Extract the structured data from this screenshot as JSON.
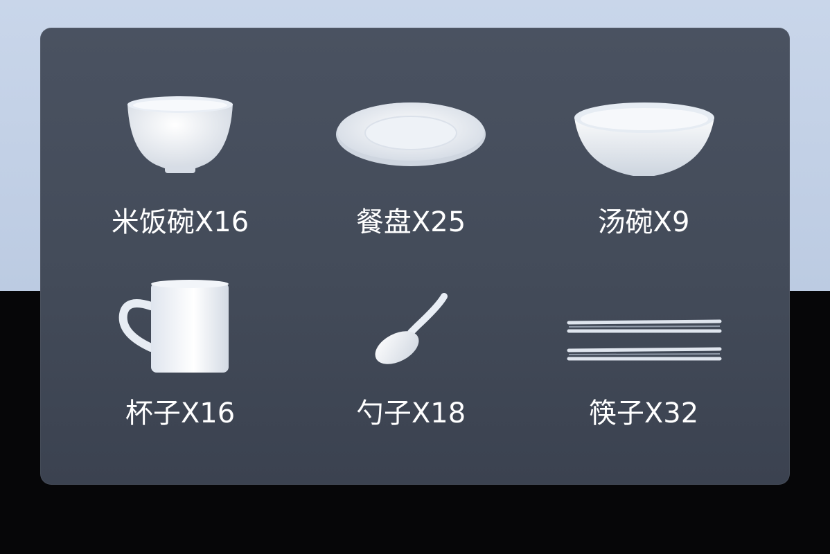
{
  "items": [
    {
      "label": "米饭碗X16",
      "icon": "rice-bowl-icon"
    },
    {
      "label": "餐盘X25",
      "icon": "plate-icon"
    },
    {
      "label": "汤碗X9",
      "icon": "soup-bowl-icon"
    },
    {
      "label": "杯子X16",
      "icon": "mug-icon"
    },
    {
      "label": "勺子X18",
      "icon": "spoon-icon"
    },
    {
      "label": "筷子X32",
      "icon": "chopsticks-icon"
    }
  ]
}
